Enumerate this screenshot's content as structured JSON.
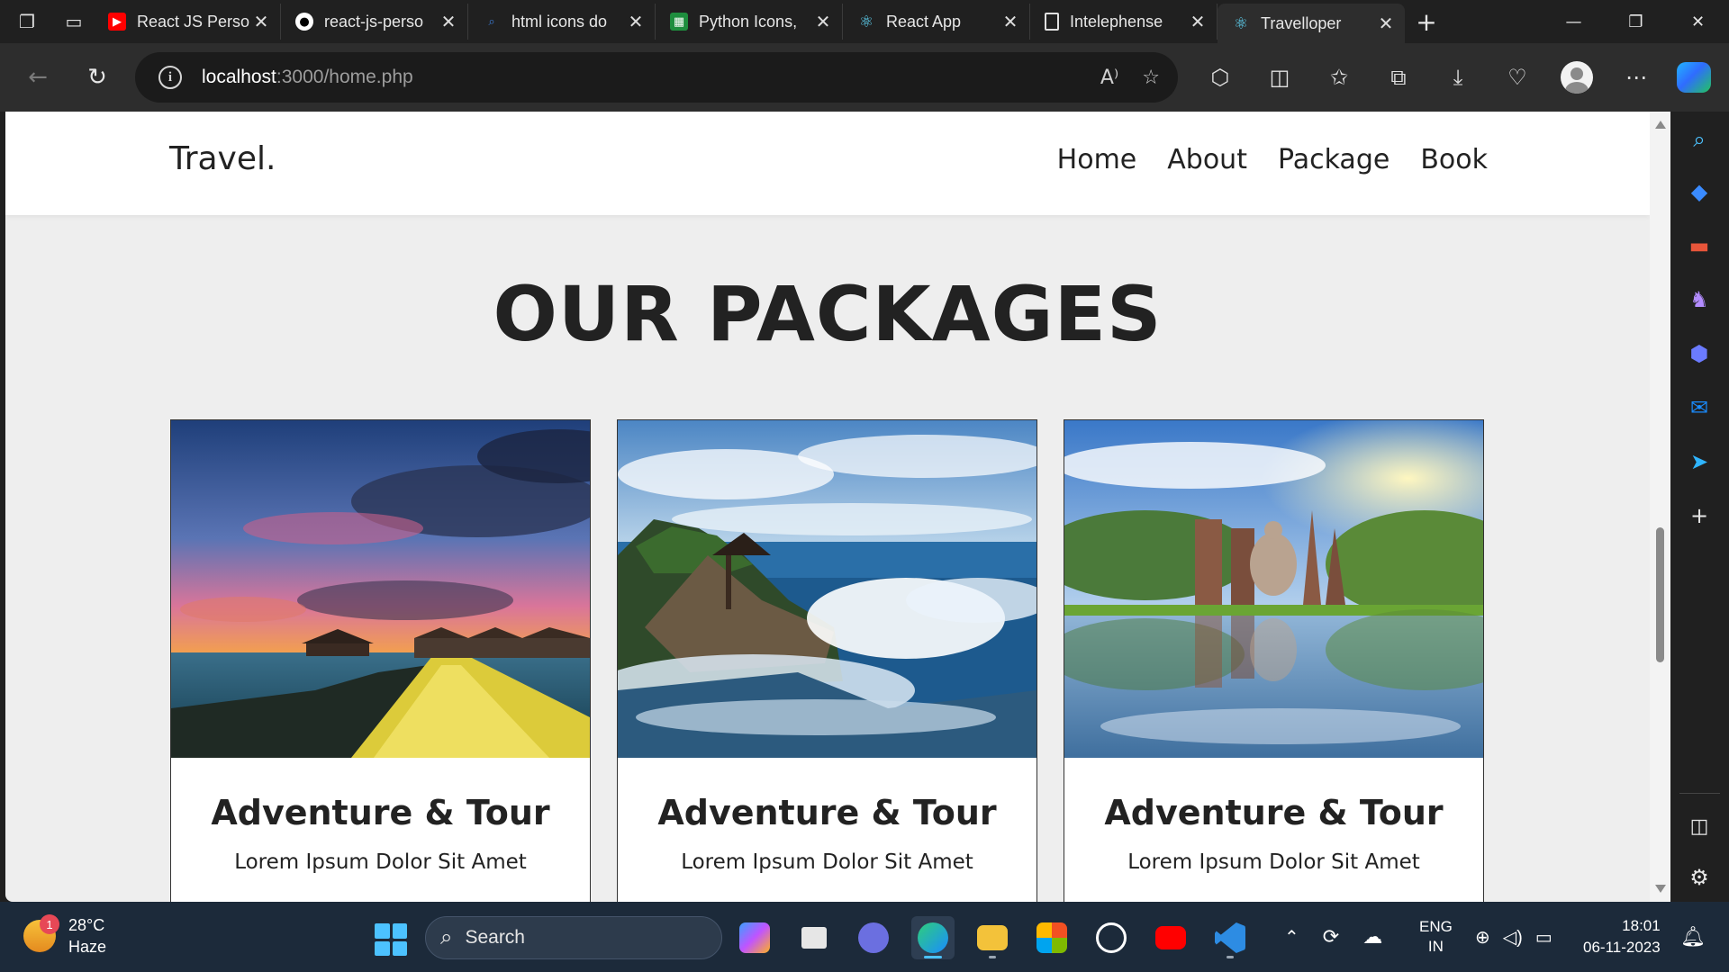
{
  "browser": {
    "tabs": [
      {
        "title": "React JS Perso",
        "icon": "youtube-icon",
        "color": "#ff0000"
      },
      {
        "title": "react-js-perso",
        "icon": "github-icon",
        "color": "#ffffff"
      },
      {
        "title": "html icons do",
        "icon": "search-icon",
        "color": "#3a7bd5"
      },
      {
        "title": "Python Icons,",
        "icon": "sheet-icon",
        "color": "#1e8e3e"
      },
      {
        "title": "React App",
        "icon": "react-icon",
        "color": "#61dafb"
      },
      {
        "title": "Intelephense",
        "icon": "page-icon",
        "color": "#e0e0e0"
      },
      {
        "title": "Travelloper",
        "icon": "react-icon",
        "color": "#61dafb",
        "active": true
      }
    ],
    "address": {
      "host": "localhost",
      "path": ":3000/home.php"
    }
  },
  "site": {
    "logo": "Travel.",
    "nav": [
      "Home",
      "About",
      "Package",
      "Book"
    ],
    "section_title": "OUR PACKAGES",
    "cards": [
      {
        "title": "Adventure & Tour",
        "text": "Lorem Ipsum Dolor Sit Amet",
        "image": "maldives-sunset-boardwalk"
      },
      {
        "title": "Adventure & Tour",
        "text": "Lorem Ipsum Dolor Sit Amet",
        "image": "bali-temple-waves"
      },
      {
        "title": "Adventure & Tour",
        "text": "Lorem Ipsum Dolor Sit Amet",
        "image": "sukhothai-temple-reflection"
      }
    ]
  },
  "taskbar": {
    "weather": {
      "temp": "28°C",
      "condition": "Haze",
      "badge": "1"
    },
    "search_label": "Search",
    "lang": {
      "line1": "ENG",
      "line2": "IN"
    },
    "clock": {
      "time": "18:01",
      "date": "06-11-2023"
    }
  }
}
